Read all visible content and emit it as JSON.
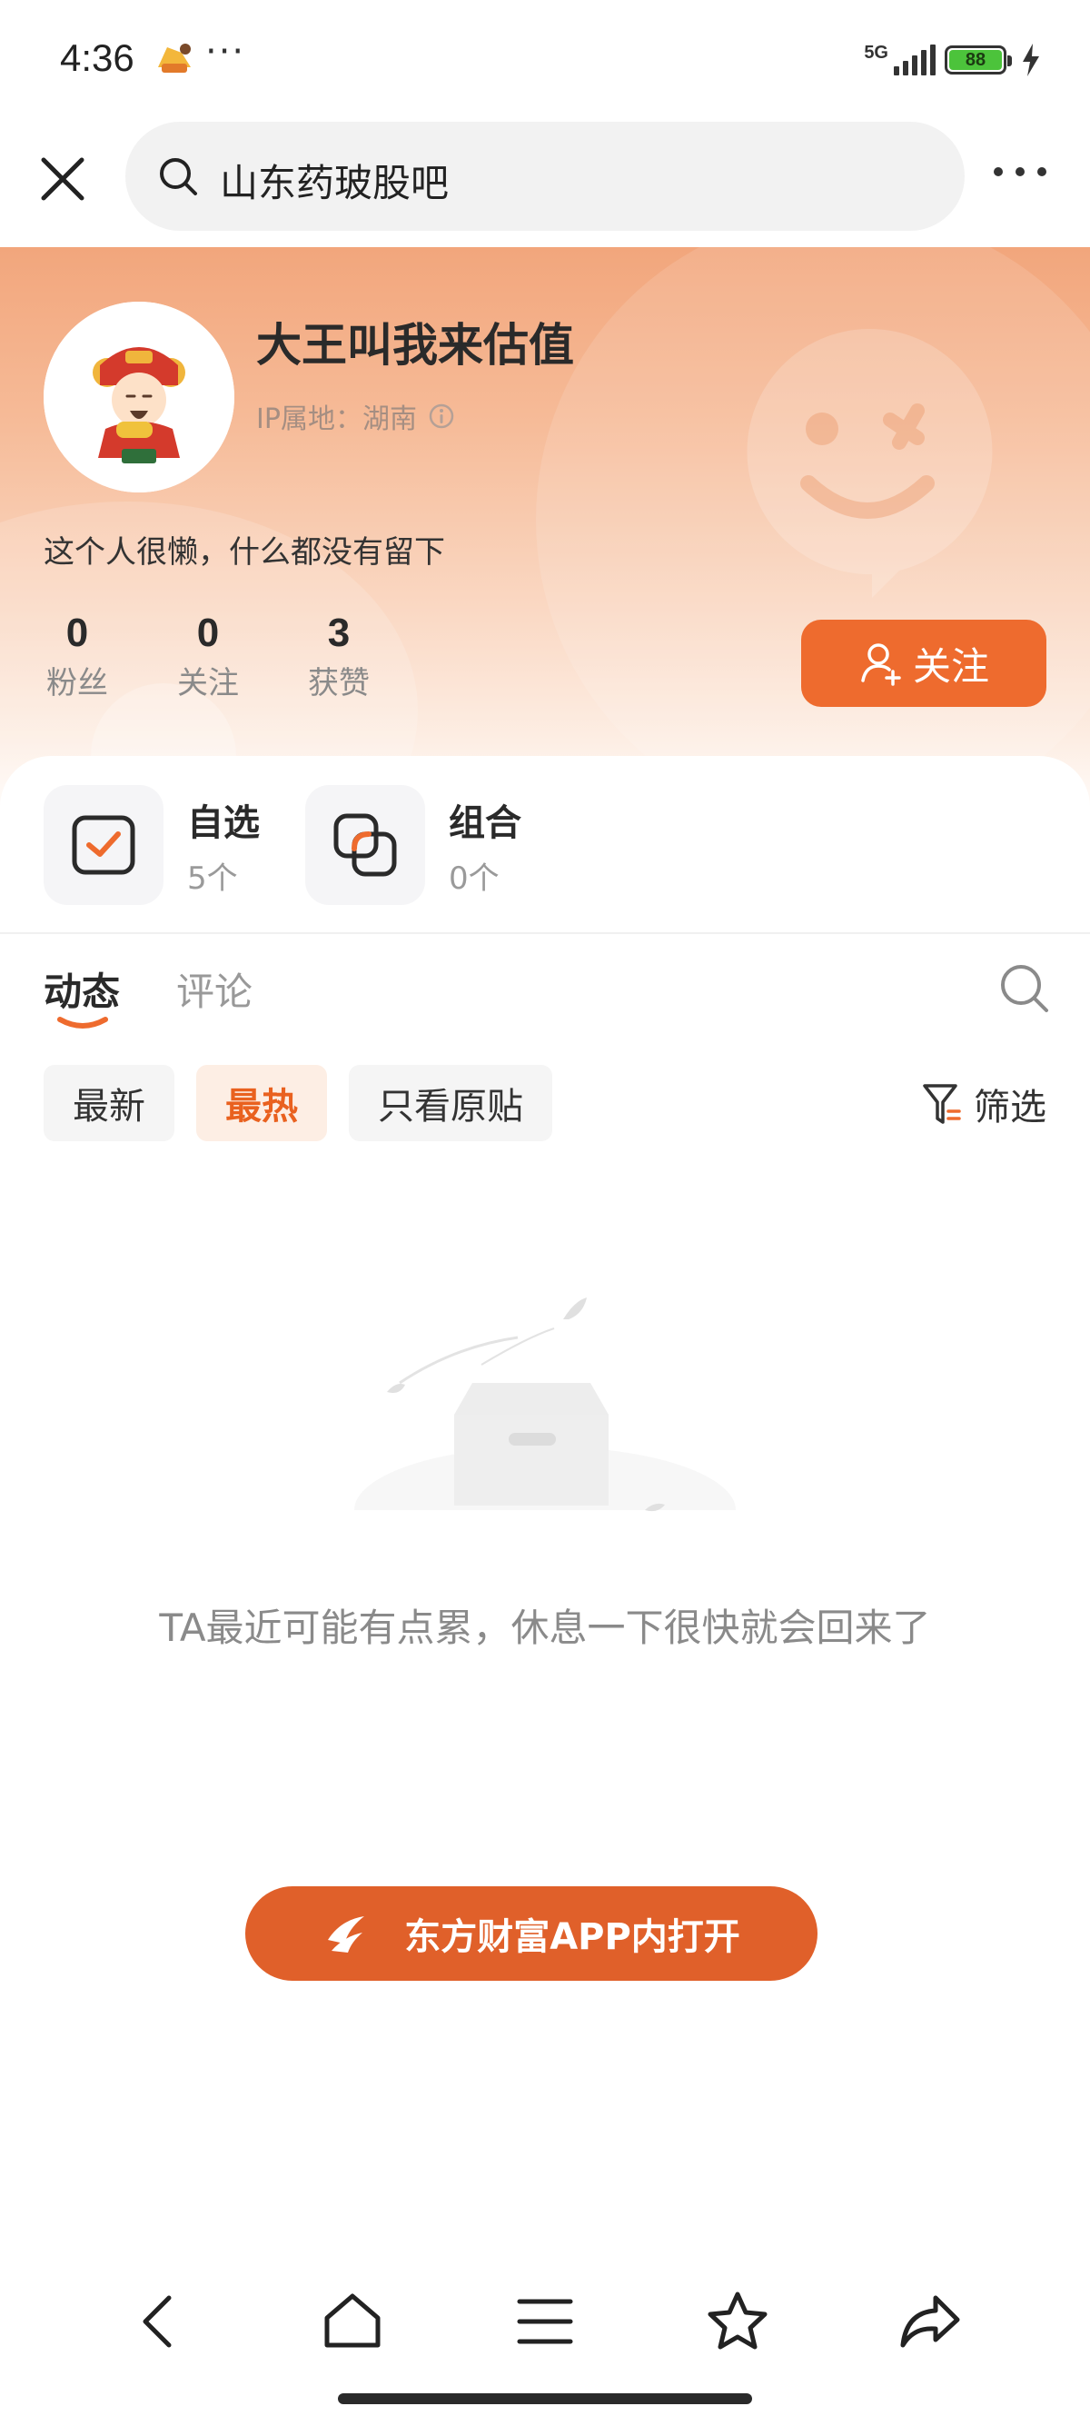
{
  "status_bar": {
    "time": "4:36",
    "dots": "···",
    "network": "5G",
    "battery": "88"
  },
  "search": {
    "query": "山东药玻股吧"
  },
  "profile": {
    "username": "大王叫我来估值",
    "ip_label": "IP属地：湖南",
    "bio": "这个人很懒，什么都没有留下",
    "stats": [
      {
        "value": "0",
        "label": "粉丝"
      },
      {
        "value": "0",
        "label": "关注"
      },
      {
        "value": "3",
        "label": "获赞"
      }
    ],
    "follow_label": "关注"
  },
  "quick_links": [
    {
      "title": "自选",
      "count": "5个"
    },
    {
      "title": "组合",
      "count": "0个"
    }
  ],
  "tabs": [
    {
      "label": "动态",
      "active": true
    },
    {
      "label": "评论",
      "active": false
    }
  ],
  "filters": [
    {
      "label": "最新",
      "active": false
    },
    {
      "label": "最热",
      "active": true
    },
    {
      "label": "只看原贴",
      "active": false
    }
  ],
  "filter_button": "筛选",
  "empty_message": "TA最近可能有点累，休息一下很快就会回来了",
  "open_app_label": "东方财富APP内打开",
  "colors": {
    "accent": "#ee6b2e",
    "accent_dark": "#e0602a",
    "hero_top": "#f2a67c"
  }
}
